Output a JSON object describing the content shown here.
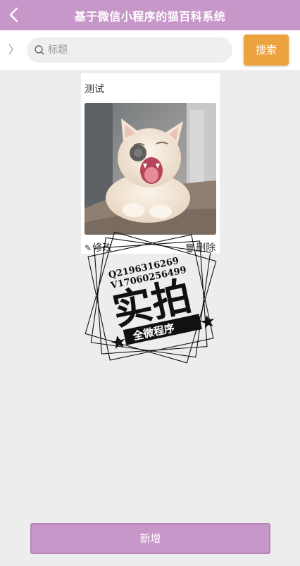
{
  "navbar": {
    "title": "基于微信小程序的猫百科系统",
    "back_icon": "chevron-left-icon"
  },
  "search": {
    "placeholder": "标题",
    "button_label": "搜索",
    "icon": "search-icon",
    "side_icon": "chevron-right-icon"
  },
  "card": {
    "title": "测试",
    "edit_label": "修改",
    "delete_label": "删除",
    "image_alt": "cat yawning photo"
  },
  "watermark": {
    "line1": "Q2196316269",
    "line2": "V17060256499",
    "big": "实拍",
    "banner": "全微程序"
  },
  "footer": {
    "add_label": "新增"
  },
  "colors": {
    "accent": "#c897c9",
    "search_button": "#eba23f",
    "background": "#ededed"
  }
}
